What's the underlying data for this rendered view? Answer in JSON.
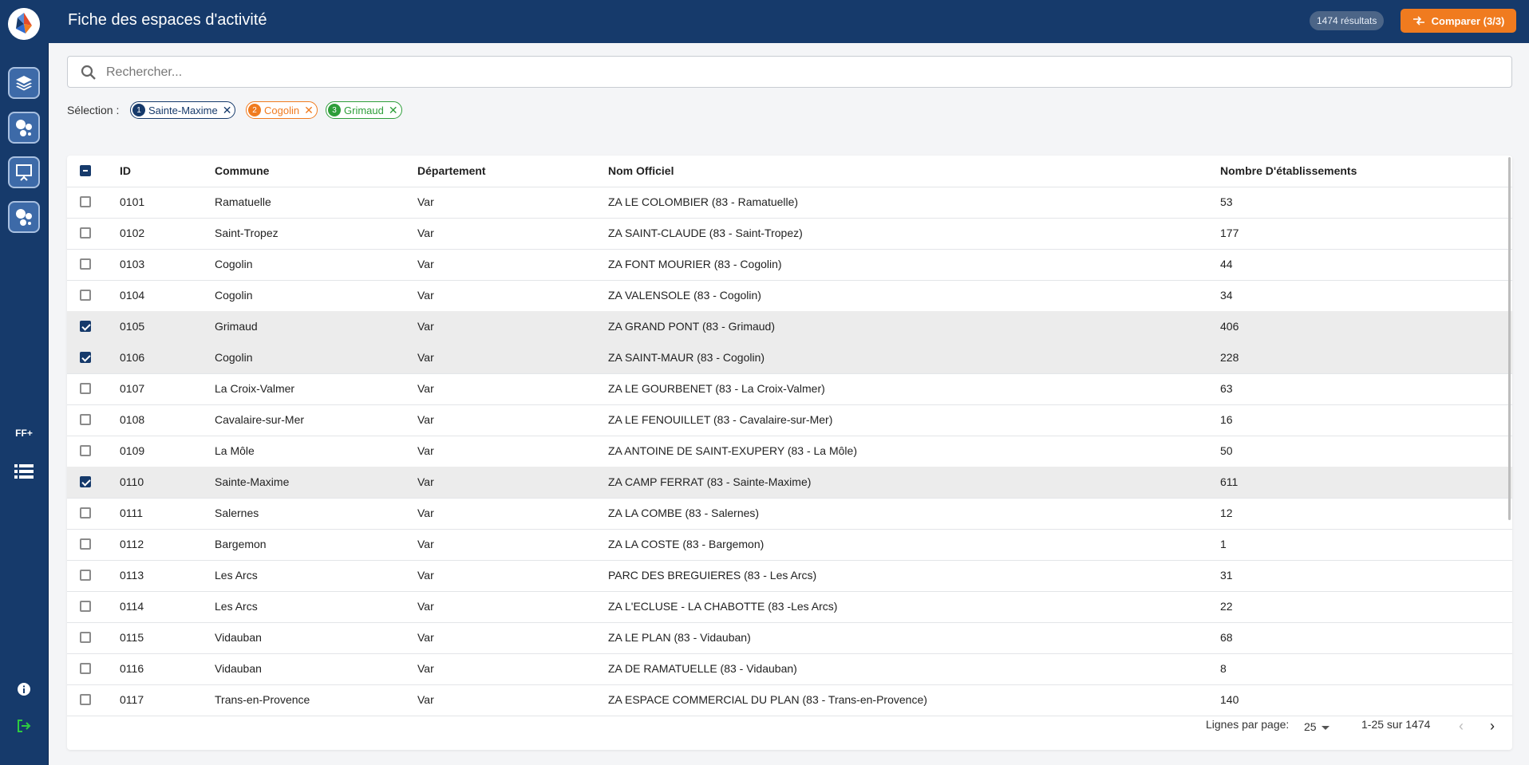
{
  "header": {
    "title": "Fiche des espaces d'activité",
    "results_badge": "1474 résultats",
    "compare_label": "Comparer (3/3)"
  },
  "sidebar": {
    "items": [
      {
        "icon": "layers-icon"
      },
      {
        "icon": "bubbles-icon"
      },
      {
        "icon": "presentation-icon"
      },
      {
        "icon": "bubbles-icon"
      }
    ],
    "ff_label": "FF+",
    "list_icon": "list-icon",
    "info_icon": "info-icon",
    "logout_icon": "logout-icon"
  },
  "search": {
    "placeholder": "Rechercher..."
  },
  "selection": {
    "label": "Sélection :",
    "chips": [
      {
        "num": "1",
        "label": "Sainte-Maxime",
        "color": "#163a6b"
      },
      {
        "num": "2",
        "label": "Cogolin",
        "color": "#f07b1f"
      },
      {
        "num": "3",
        "label": "Grimaud",
        "color": "#2e9e3a"
      }
    ]
  },
  "table": {
    "columns": [
      "ID",
      "Commune",
      "Département",
      "Nom Officiel",
      "Nombre D'établissements"
    ],
    "rows": [
      {
        "id": "0101",
        "commune": "Ramatuelle",
        "dept": "Var",
        "nom": "ZA LE COLOMBIER (83 - Ramatuelle)",
        "nb": "53",
        "checked": false
      },
      {
        "id": "0102",
        "commune": "Saint-Tropez",
        "dept": "Var",
        "nom": "ZA SAINT-CLAUDE (83 - Saint-Tropez)",
        "nb": "177",
        "checked": false
      },
      {
        "id": "0103",
        "commune": "Cogolin",
        "dept": "Var",
        "nom": "ZA FONT MOURIER (83 - Cogolin)",
        "nb": "44",
        "checked": false
      },
      {
        "id": "0104",
        "commune": "Cogolin",
        "dept": "Var",
        "nom": "ZA VALENSOLE (83 - Cogolin)",
        "nb": "34",
        "checked": false
      },
      {
        "id": "0105",
        "commune": "Grimaud",
        "dept": "Var",
        "nom": "ZA GRAND PONT (83 - Grimaud)",
        "nb": "406",
        "checked": true
      },
      {
        "id": "0106",
        "commune": "Cogolin",
        "dept": "Var",
        "nom": "ZA SAINT-MAUR (83 - Cogolin)",
        "nb": "228",
        "checked": true
      },
      {
        "id": "0107",
        "commune": "La Croix-Valmer",
        "dept": "Var",
        "nom": "ZA LE GOURBENET (83 - La Croix-Valmer)",
        "nb": "63",
        "checked": false
      },
      {
        "id": "0108",
        "commune": "Cavalaire-sur-Mer",
        "dept": "Var",
        "nom": "ZA LE FENOUILLET (83 - Cavalaire-sur-Mer)",
        "nb": "16",
        "checked": false
      },
      {
        "id": "0109",
        "commune": "La Môle",
        "dept": "Var",
        "nom": "ZA ANTOINE DE SAINT-EXUPERY (83 - La Môle)",
        "nb": "50",
        "checked": false
      },
      {
        "id": "0110",
        "commune": "Sainte-Maxime",
        "dept": "Var",
        "nom": "ZA CAMP FERRAT (83 - Sainte-Maxime)",
        "nb": "611",
        "checked": true
      },
      {
        "id": "0111",
        "commune": "Salernes",
        "dept": "Var",
        "nom": "ZA LA COMBE (83 - Salernes)",
        "nb": "12",
        "checked": false
      },
      {
        "id": "0112",
        "commune": "Bargemon",
        "dept": "Var",
        "nom": "ZA LA COSTE (83 - Bargemon)",
        "nb": "1",
        "checked": false
      },
      {
        "id": "0113",
        "commune": "Les Arcs",
        "dept": "Var",
        "nom": "PARC DES BREGUIERES (83 - Les Arcs)",
        "nb": "31",
        "checked": false
      },
      {
        "id": "0114",
        "commune": "Les Arcs",
        "dept": "Var",
        "nom": "ZA L'ECLUSE - LA CHABOTTE (83 -Les Arcs)",
        "nb": "22",
        "checked": false
      },
      {
        "id": "0115",
        "commune": "Vidauban",
        "dept": "Var",
        "nom": "ZA LE PLAN (83 - Vidauban)",
        "nb": "68",
        "checked": false
      },
      {
        "id": "0116",
        "commune": "Vidauban",
        "dept": "Var",
        "nom": "ZA DE RAMATUELLE (83 - Vidauban)",
        "nb": "8",
        "checked": false
      },
      {
        "id": "0117",
        "commune": "Trans-en-Provence",
        "dept": "Var",
        "nom": "ZA ESPACE COMMERCIAL DU PLAN (83 - Trans-en-Provence)",
        "nb": "140",
        "checked": false
      }
    ]
  },
  "pagination": {
    "rows_label": "Lignes par page:",
    "rows_value": "25",
    "range": "1-25 sur 1474"
  }
}
